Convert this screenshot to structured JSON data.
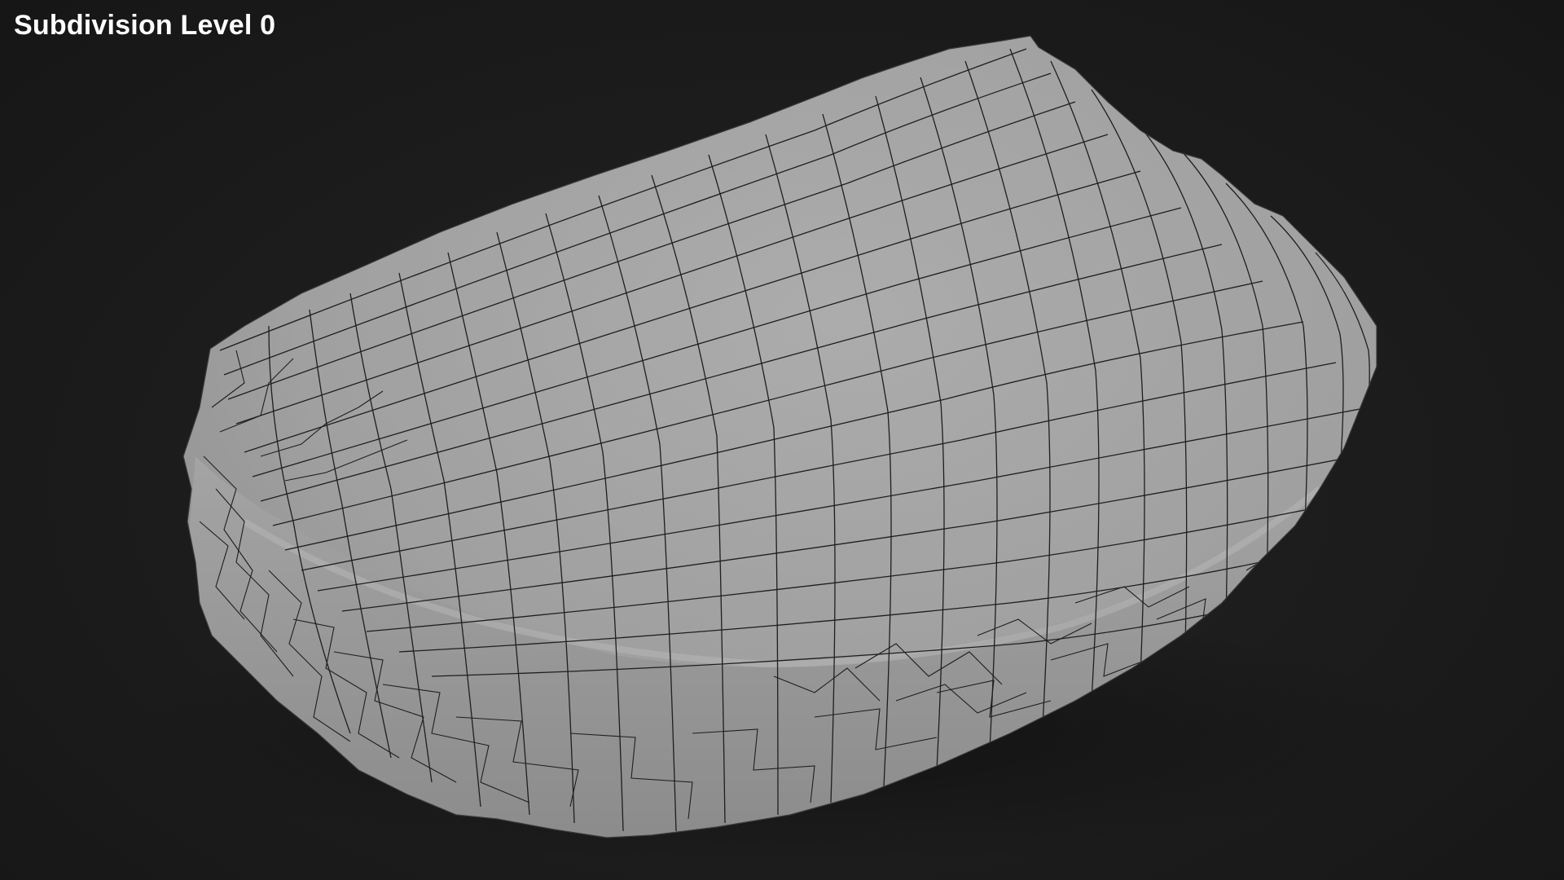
{
  "viewport": {
    "overlay_label": "Subdivision Level 0",
    "background_color": "#1b1b1b",
    "mesh_fill_color": "#a2a2a2",
    "wire_color": "#1e1e1e"
  },
  "model": {
    "object": "rock-mesh",
    "display": "wireframe-on-shaded"
  }
}
